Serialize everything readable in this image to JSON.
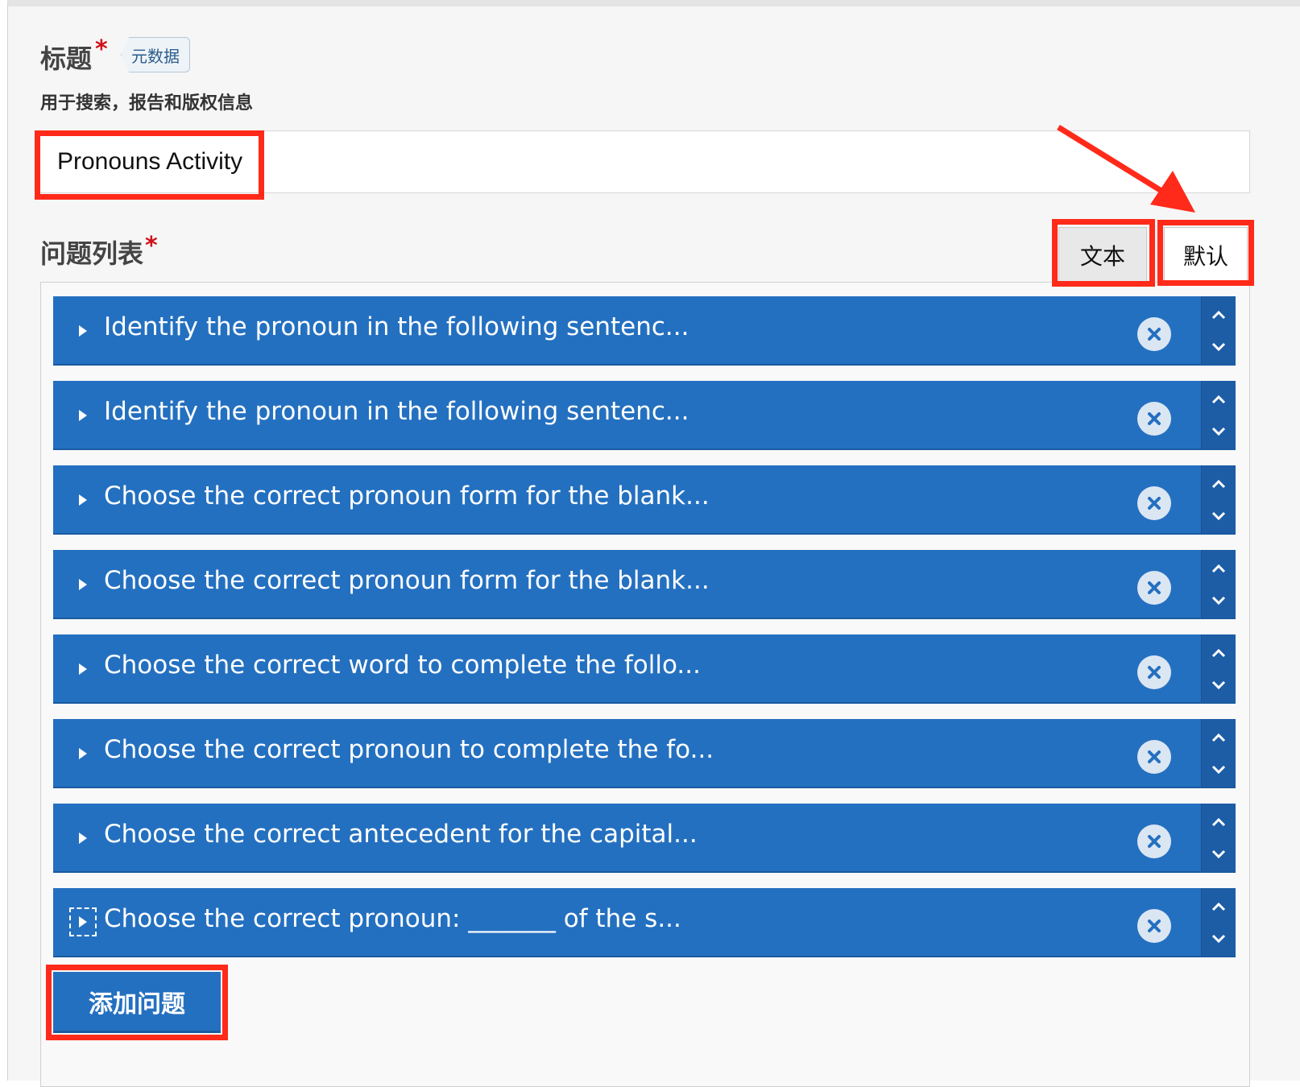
{
  "form": {
    "title_label": "标题",
    "required_mark": "*",
    "metadata_tag": "元数据",
    "title_hint": "用于搜索，报告和版权信息",
    "title_value": "Pronouns Activity",
    "question_list_label": "问题列表",
    "mode_text_button": "文本",
    "mode_default_button": "默认",
    "add_question_button": "添加问题"
  },
  "questions": [
    {
      "label": "Identify the pronoun in the following sentenc..."
    },
    {
      "label": "Identify the pronoun in the following sentenc..."
    },
    {
      "label": "Choose the correct pronoun form for the blank..."
    },
    {
      "label": "Choose the correct pronoun form for the blank..."
    },
    {
      "label": "Choose the correct word to complete the follo..."
    },
    {
      "label": "Choose the correct pronoun to complete the fo..."
    },
    {
      "label": "Choose the correct antecedent for the capital..."
    },
    {
      "label": "Choose the correct pronoun: _______ of the s..."
    }
  ],
  "icons": {
    "expand": "caret-right-icon",
    "remove": "close-circle-icon",
    "move_up": "chevron-up-icon",
    "move_down": "chevron-down-icon"
  },
  "colors": {
    "item_bg": "#2470c0",
    "annotation": "#ff2a1a",
    "required": "#d0121b"
  }
}
